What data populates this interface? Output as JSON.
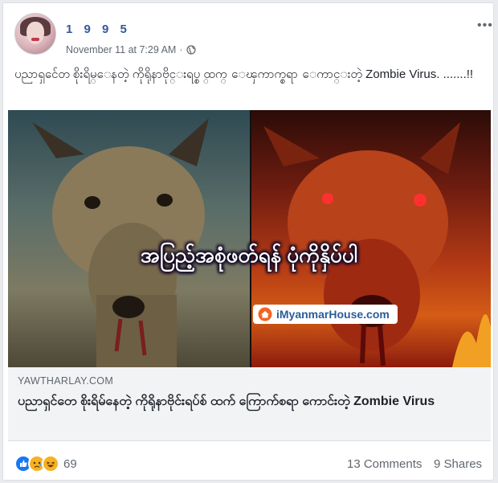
{
  "post": {
    "author": "1 9 9 5",
    "timestamp": "November 11 at 7:29 AM",
    "separator": "·",
    "privacy_icon": "globe-icon",
    "menu_label": "•••",
    "text": "ပညာရှင်ေတ စိုးရိမ္ေနတဲ့ ကိုရိုနာဗိုင္းရပ္စ္ ထက္ ေၾကာက္စရာ ေကာင္းတဲ့ Zombie Virus. .......!!"
  },
  "image": {
    "overlay_text": "အပြည့်အစုံဖတ်ရန် ပုံကိုနှိပ်ပါ",
    "watermark_text": "iMyanmarHouse.com",
    "left_panel_subject": "deer",
    "right_panel_subject": "zombie-deer"
  },
  "link_preview": {
    "domain": "YAWTHARLAY.COM",
    "title": "ပညာရှင်တေ စိုးရိမ်နေတဲ့ ကိုရိုနာဗိုင်းရပ်စ် ထက် ကြောက်စရာ ကောင်းတဲ့ Zombie Virus"
  },
  "footer": {
    "reaction_icons": [
      "like-icon",
      "sad-icon",
      "haha-icon"
    ],
    "reaction_count": "69",
    "comments": "13 Comments",
    "shares": "9 Shares"
  },
  "colors": {
    "author_link": "#365899",
    "meta_text": "#606770",
    "like_blue": "#1877f2",
    "emoji_yellow": "#f7b125"
  }
}
